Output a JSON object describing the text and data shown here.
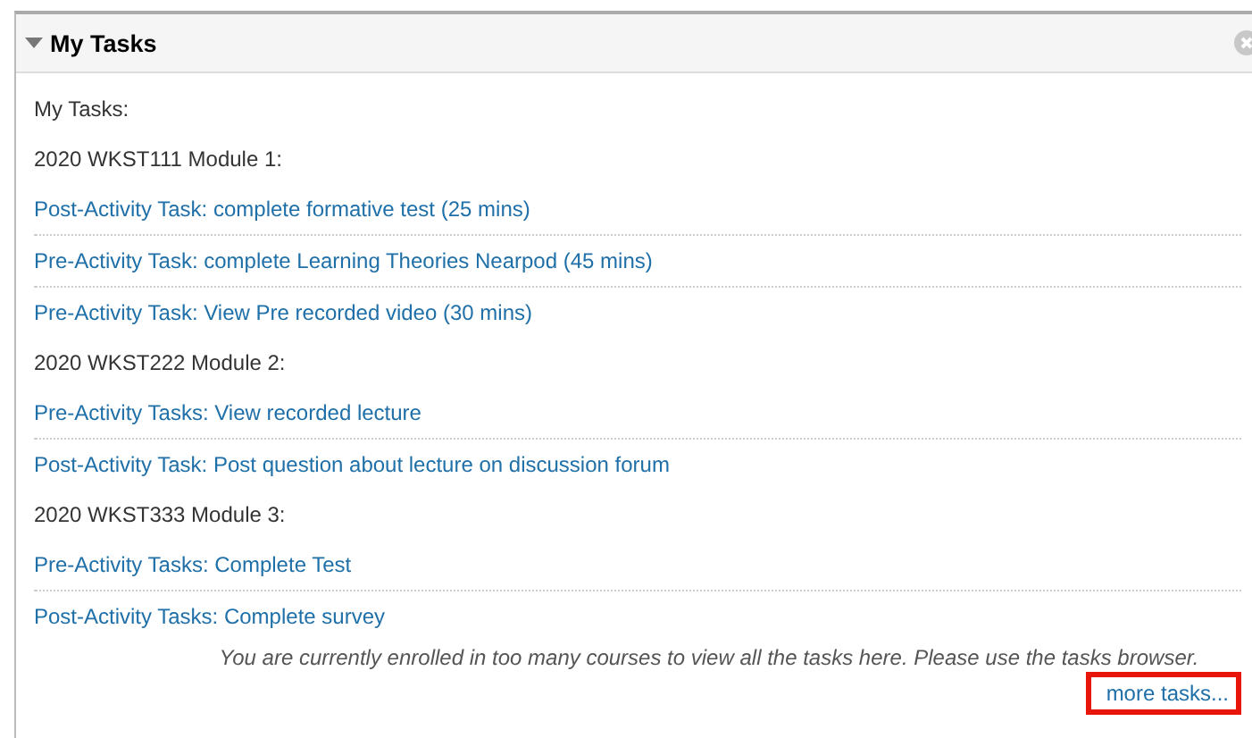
{
  "panel": {
    "title": "My Tasks",
    "expanded": true
  },
  "intro": "My Tasks:",
  "modules": [
    {
      "title": "2020 WKST111 Module 1:",
      "tasks": [
        "Post-Activity Task: complete formative test (25 mins)",
        "Pre-Activity Task: complete Learning Theories Nearpod (45 mins)",
        "Pre-Activity Task: View Pre recorded video (30 mins)"
      ]
    },
    {
      "title": "2020 WKST222 Module 2:",
      "tasks": [
        "Pre-Activity Tasks: View recorded lecture",
        "Post-Activity Task: Post question about lecture on discussion forum"
      ]
    },
    {
      "title": "2020 WKST333 Module 3:",
      "tasks": [
        "Pre-Activity Tasks: Complete Test",
        "Post-Activity Tasks: Complete survey"
      ]
    }
  ],
  "note": "You are currently enrolled in too many courses to view all the tasks here. Please use the tasks browser.",
  "more_link": {
    "label": "more tasks...",
    "highlighted": true
  }
}
